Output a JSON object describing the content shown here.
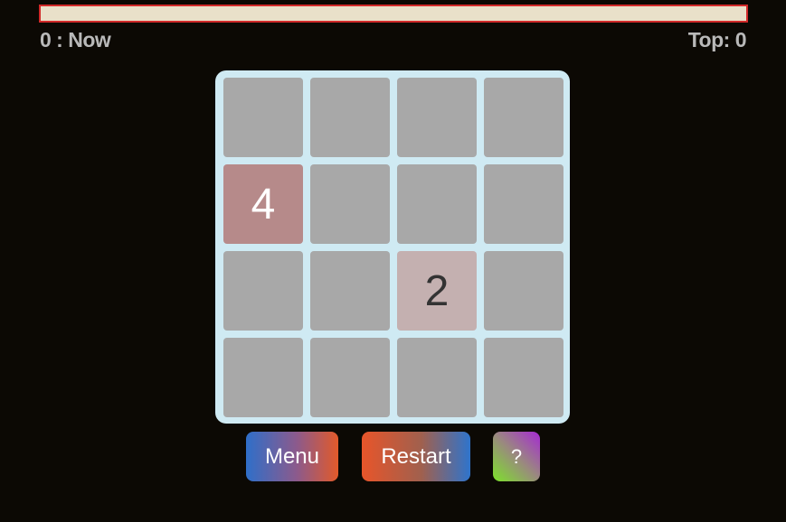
{
  "header": {
    "progress": 0,
    "score_now_label": "0 : Now",
    "score_top_label": "Top: 0"
  },
  "board": {
    "size": 4,
    "cells": [
      [
        "",
        "",
        "",
        ""
      ],
      [
        "4",
        "",
        "",
        ""
      ],
      [
        "",
        "",
        "2",
        ""
      ],
      [
        "",
        "",
        "",
        ""
      ]
    ],
    "tile_colors": {
      "2": {
        "bg": "#c4b0b0",
        "fg": "#333333"
      },
      "4": {
        "bg": "#b68a8a",
        "fg": "#ffffff"
      }
    },
    "empty_color": "#a8a8a8",
    "frame_color": "#cfeaf3"
  },
  "buttons": {
    "menu_label": "Menu",
    "restart_label": "Restart",
    "help_label": "?"
  },
  "colors": {
    "background": "#0c0904",
    "progress_border": "#d22a2a",
    "progress_track": "#e9e0c9",
    "score_text": "#b9b9b9"
  }
}
